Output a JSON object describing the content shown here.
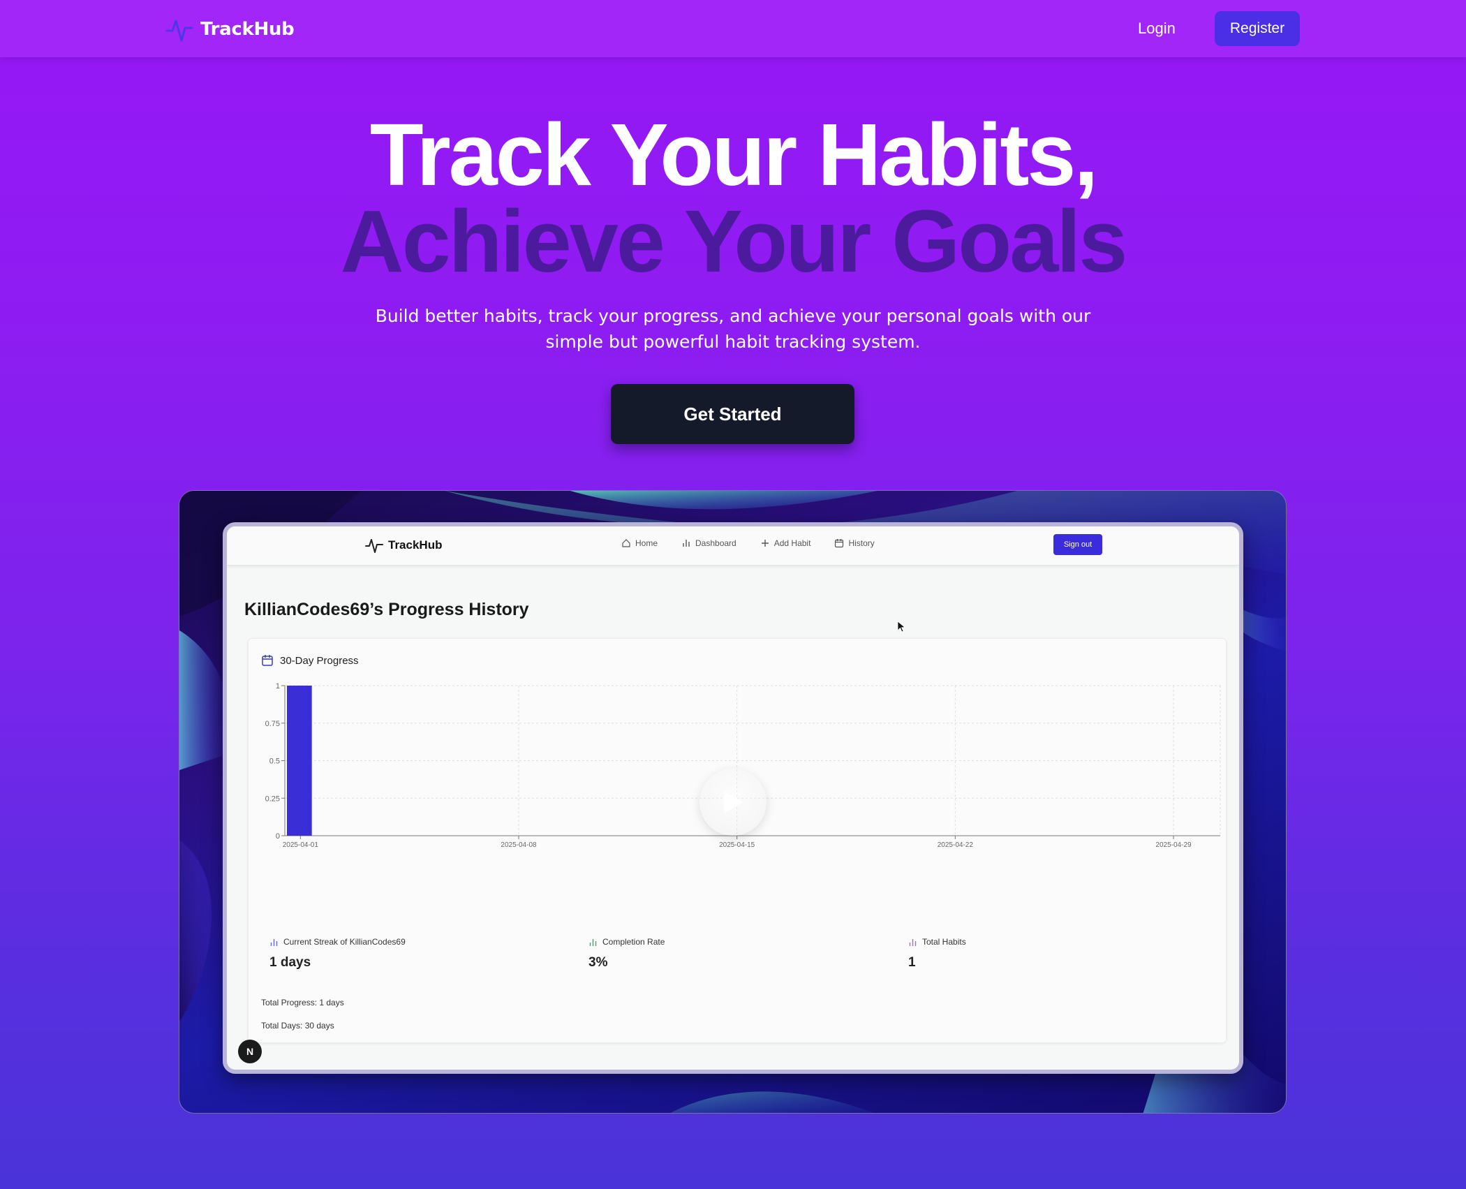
{
  "nav": {
    "brand": "TrackHub",
    "login": "Login",
    "register": "Register"
  },
  "hero": {
    "line1": "Track Your Habits,",
    "line2": "Achieve Your Goals",
    "subtitle_line1": "Build better habits, track your progress, and achieve your personal goals with our",
    "subtitle_line2": "simple but powerful habit tracking system.",
    "cta": "Get Started"
  },
  "video": {
    "app": {
      "brand": "TrackHub",
      "links": [
        {
          "label": "Home",
          "icon": "home-icon"
        },
        {
          "label": "Dashboard",
          "icon": "bar-chart-icon"
        },
        {
          "label": "Add Habit",
          "icon": "plus-icon"
        },
        {
          "label": "History",
          "icon": "calendar-icon"
        }
      ],
      "sign_out": "Sign out",
      "page_title": "KillianCodes69’s Progress History",
      "card_title": "30-Day Progress",
      "stats": [
        {
          "label": "Current Streak of KillianCodes69",
          "value": "1 days",
          "bg": "#e6e8f6",
          "icon_color": "#6a6ad6"
        },
        {
          "label": "Completion Rate",
          "value": "3%",
          "bg": "#e7f7ee",
          "icon_color": "#3aa867"
        },
        {
          "label": "Total Habits",
          "value": "1",
          "bg": "#f4eef8",
          "icon_color": "#a56bc9"
        }
      ],
      "total_progress": "Total Progress: 1 days",
      "total_days": "Total Days: 30 days",
      "badge": "N"
    }
  },
  "chart_data": {
    "type": "bar",
    "x": [
      "2025-04-01"
    ],
    "values": [
      1
    ],
    "x_ticks": [
      "2025-04-01",
      "2025-04-08",
      "2025-04-15",
      "2025-04-22",
      "2025-04-29"
    ],
    "y_ticks": [
      "0",
      "0.25",
      "0.5",
      "0.75",
      "1"
    ],
    "ylim": [
      0,
      1
    ],
    "grid": true,
    "bar_color": "#3a2fd6",
    "title": "30-Day Progress"
  }
}
